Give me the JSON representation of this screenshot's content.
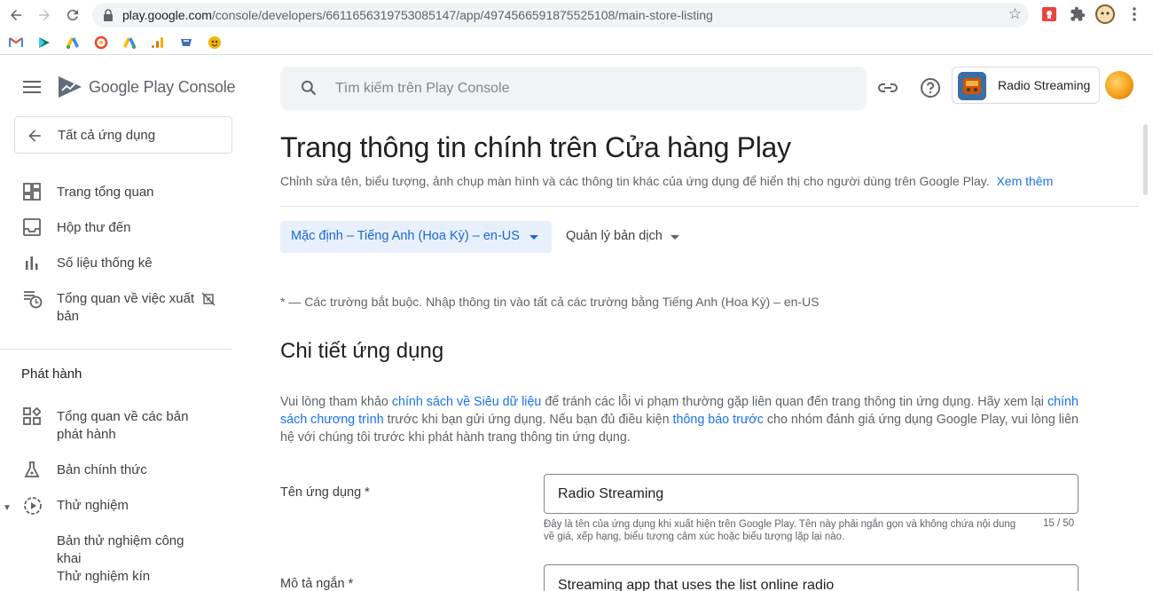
{
  "browser": {
    "url_host": "play.google.com",
    "url_path": "/console/developers/6611656319753085147/app/4974566591875525108/main-store-listing",
    "nav": [
      "back-icon",
      "forward-icon",
      "reload-icon"
    ],
    "extensions": [
      "adblock-extension-icon",
      "puzzle-extensions-icon",
      "profile-avatar-icon",
      "more-vert-icon"
    ],
    "bookmarks": [
      "gmail-icon",
      "play-console-icon",
      "google-ads-icon",
      "quora-icon",
      "google-ads-2-icon",
      "analytics-icon",
      "bookmark-7-icon",
      "bookmark-8-icon"
    ]
  },
  "sidebar": {
    "logo": {
      "google": "Google",
      "play": "Play",
      "console": "Console"
    },
    "all_apps": "Tất cả ứng dụng",
    "items": [
      {
        "label": "Trang tổng quan",
        "icon": "dashboard-icon"
      },
      {
        "label": "Hộp thư đến",
        "icon": "inbox-icon"
      },
      {
        "label": "Số liệu thống kê",
        "icon": "statistics-icon"
      },
      {
        "label": "Tổng quan về việc xuất bản",
        "icon": "publishing-overview-icon"
      }
    ],
    "release_section": "Phát hành",
    "release_items": [
      {
        "label": "Tổng quan về các bản phát hành",
        "icon": "releases-overview-icon"
      },
      {
        "label": "Bản chính thức",
        "icon": "production-icon"
      },
      {
        "label": "Thử nghiệm",
        "icon": "testing-icon"
      },
      {
        "label": "Bản thử nghiệm công khai",
        "icon": ""
      },
      {
        "label": "Thử nghiệm kín",
        "icon": ""
      }
    ]
  },
  "header": {
    "search_placeholder": "Tìm kiếm trên Play Console",
    "app_name": "Radio Streaming"
  },
  "main": {
    "title": "Trang thông tin chính trên Cửa hàng Play",
    "subtitle": "Chỉnh sửa tên, biểu tượng, ảnh chụp màn hình và các thông tin khác của ứng dụng để hiển thị cho người dùng trên Google Play.",
    "learn_more": "Xem thêm",
    "language_button": "Mặc định – Tiếng Anh (Hoa Kỳ) – en-US",
    "manage_translations": "Quản lý bản dịch",
    "required_note": "* — Các trường bắt buộc. Nhập thông tin vào tất cả các trường bằng Tiếng Anh (Hoa Kỳ) – en-US",
    "section_title": "Chi tiết ứng dụng",
    "policy": {
      "t1": "Vui lòng tham khảo ",
      "l1": "chính sách về Siêu dữ liệu",
      "t2": " để tránh các lỗi vi phạm thường gặp liên quan đến trang thông tin ứng dụng. Hãy xem lại ",
      "l2": "chính sách chương trình",
      "t3": " trước khi bạn gửi ứng dụng. Nếu bạn đủ điều kiện ",
      "l3": "thông báo trước",
      "t4": " cho nhóm đánh giá ứng dụng Google Play, vui lòng liên hệ với chúng tôi trước khi phát hành trang thông tin ứng dụng."
    },
    "fields": {
      "app_name_label": "Tên ứng dụng  *",
      "app_name_value": "Radio Streaming",
      "app_name_helper": "Đây là tên của ứng dụng khi xuất hiện trên Google Play. Tên này phải ngắn gọn và không chứa nội dung về giá, xếp hạng, biểu tượng cảm xúc hoặc biểu tượng lặp lại nào.",
      "app_name_counter": "15 / 50",
      "short_desc_label": "Mô tả ngắn  *",
      "short_desc_value": "Streaming app that uses the list online radio"
    }
  }
}
